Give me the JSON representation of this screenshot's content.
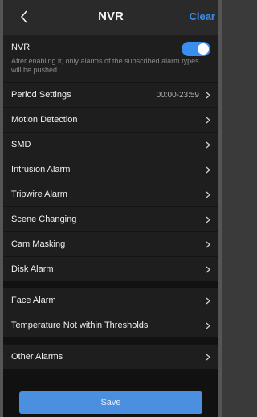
{
  "header": {
    "back_icon": "chevron-left-icon",
    "title": "NVR",
    "clear_label": "Clear",
    "accent_color": "#3a8ef0"
  },
  "nvr": {
    "label": "NVR",
    "enabled": true,
    "description": "After enabling it, only alarms of the subscribed alarm types will be pushed"
  },
  "period": {
    "label": "Period Settings",
    "value": "00:00-23:59"
  },
  "group1": [
    {
      "label": "Motion Detection"
    },
    {
      "label": "SMD"
    },
    {
      "label": "Intrusion Alarm"
    },
    {
      "label": "Tripwire Alarm"
    },
    {
      "label": "Scene Changing"
    },
    {
      "label": "Cam Masking"
    },
    {
      "label": "Disk Alarm"
    }
  ],
  "group2": [
    {
      "label": "Face Alarm"
    },
    {
      "label": "Temperature Not within Thresholds"
    }
  ],
  "group3": [
    {
      "label": "Other Alarms"
    }
  ],
  "save_label": "Save",
  "chevron_icon": "chevron-right-icon"
}
